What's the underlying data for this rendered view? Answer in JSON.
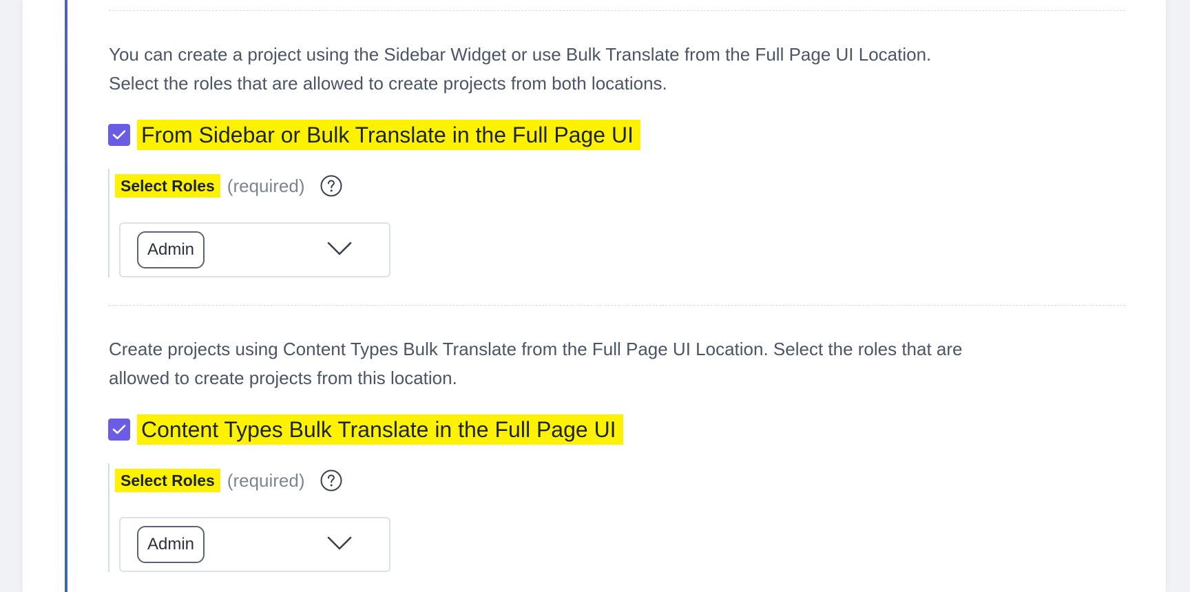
{
  "sections": [
    {
      "description_line1": "You can create a project using the Sidebar Widget or use Bulk Translate from the Full Page UI Location.",
      "description_line2": "Select the roles that are allowed to create projects from both locations.",
      "checkbox_label": "From Sidebar or Bulk Translate in the Full Page UI",
      "checked": true,
      "roles_label": "Select Roles",
      "required_text": "(required)",
      "selected_role": "Admin"
    },
    {
      "description_line1": "Create projects using Content Types Bulk Translate from the Full Page UI Location. Select the roles that are",
      "description_line2": "allowed to create projects from this location.",
      "checkbox_label": "Content Types Bulk Translate in the Full Page UI",
      "checked": true,
      "roles_label": "Select Roles",
      "required_text": "(required)",
      "selected_role": "Admin"
    }
  ],
  "icons": {
    "checkbox": "check-icon",
    "help": "question-circle-icon",
    "dropdown": "chevron-down-icon"
  },
  "colors": {
    "checkbox": "#6b5ce6",
    "highlight": "#fff200",
    "accent_rule": "#4f63b0"
  }
}
